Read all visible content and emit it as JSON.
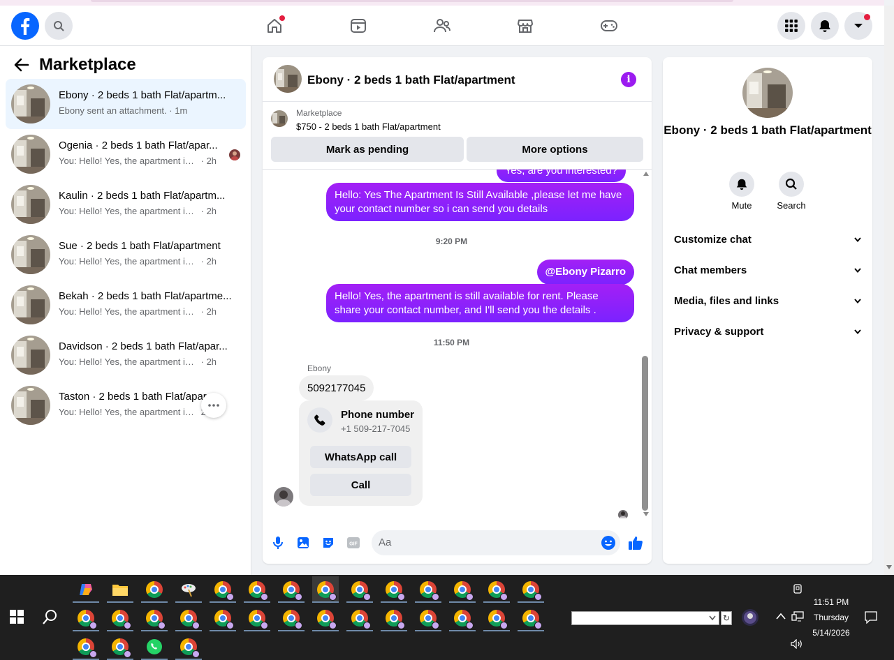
{
  "nav": {
    "logo": "facebook-logo",
    "icons": [
      "home-icon",
      "video-icon",
      "friends-icon",
      "marketplace-icon",
      "gaming-icon"
    ],
    "right_icons": [
      "menu-grid-icon",
      "bell-icon",
      "chevron-down-icon"
    ]
  },
  "sidebar": {
    "title": "Marketplace",
    "conversations": [
      {
        "title": "Ebony · 2 beds 1 bath Flat/apartm...",
        "snippet": "Ebony sent an attachment.",
        "time": "· 1m"
      },
      {
        "title": "Ogenia · 2 beds 1 bath Flat/apar...",
        "snippet": "You: Hello! Yes, the apartment is stil...",
        "time": "· 2h"
      },
      {
        "title": "Kaulin · 2 beds 1 bath Flat/apartm...",
        "snippet": "You: Hello! Yes, the apartment is still a...",
        "time": "· 2h"
      },
      {
        "title": "Sue · 2 beds 1 bath Flat/apartment",
        "snippet": "You: Hello! Yes, the apartment is still a...",
        "time": "· 2h"
      },
      {
        "title": "Bekah · 2 beds 1 bath Flat/apartme...",
        "snippet": "You: Hello! Yes, the apartment is still a...",
        "time": "· 2h"
      },
      {
        "title": "Davidson · 2 beds 1 bath Flat/apar...",
        "snippet": "You: Hello! Yes, the apartment is still a...",
        "time": "· 2h"
      },
      {
        "title": "Taston · 2 beds 1 bath Flat/apar...",
        "snippet": "You: Hello! Yes, the apartment is still",
        "time": "2h"
      }
    ]
  },
  "chat": {
    "title": "Ebony · 2 beds 1 bath Flat/apartment",
    "listing_label": "Marketplace",
    "listing_price": "$750 - 2 beds 1 bath Flat/apartment",
    "mark_pending": "Mark as pending",
    "more_options": "More options",
    "partial_msg": "Yes, are you interested?",
    "msg1": "Hello: Yes The Apartment Is Still Available ,please let me have your contact number so i can send you details",
    "time1": "9:20 PM",
    "mention": "@Ebony Pizarro",
    "msg2": "Hello! Yes, the apartment is still available for rent. Please share your contact number, and I'll send you the details .",
    "time2": "11:50 PM",
    "sender": "Ebony",
    "phone_msg": "5092177045",
    "card_title": "Phone number",
    "card_number": "+1 509-217-7045",
    "whatsapp": "WhatsApp call",
    "call": "Call",
    "composer_placeholder": "Aa"
  },
  "details": {
    "title": "Ebony · 2 beds 1 bath Flat/apartment",
    "mute": "Mute",
    "search": "Search",
    "sections": [
      "Customize chat",
      "Chat members",
      "Media, files and links",
      "Privacy & support"
    ]
  },
  "taskbar": {
    "time": "11:51 PM",
    "day": "Thursday",
    "date": "5/14/2026"
  },
  "colors": {
    "accent": "#0866ff",
    "bubble": "#9b1bf0",
    "notification": "#e41e3f"
  }
}
